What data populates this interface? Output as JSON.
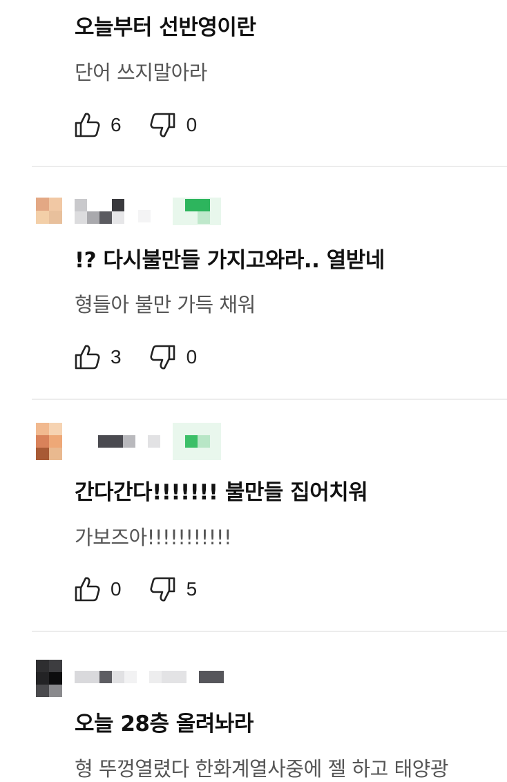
{
  "comments": [
    {
      "title": "오늘부터 선반영이란",
      "body": "단어 쓰지말아라",
      "likes": "6",
      "dislikes": "0"
    },
    {
      "title": "!? 다시불만들 가지고와라.. 열받네",
      "body": "형들아 불만 가득 채워",
      "likes": "3",
      "dislikes": "0"
    },
    {
      "title": "간다간다!!!!!!! 불만들 집어치워",
      "body": "가보즈아!!!!!!!!!!!",
      "likes": "0",
      "dislikes": "5"
    },
    {
      "title": "오늘 28층 올려놔라",
      "body": "형 뚜껑열렸다 한화계열사중에 젤 하고 태양광"
    }
  ],
  "icons": {
    "like": "thumbs-up-icon",
    "dislike": "thumbs-down-icon"
  },
  "colors": {
    "divider": "#ececec",
    "title": "#111111",
    "body": "#555555",
    "badge_green": "#2db55d"
  }
}
